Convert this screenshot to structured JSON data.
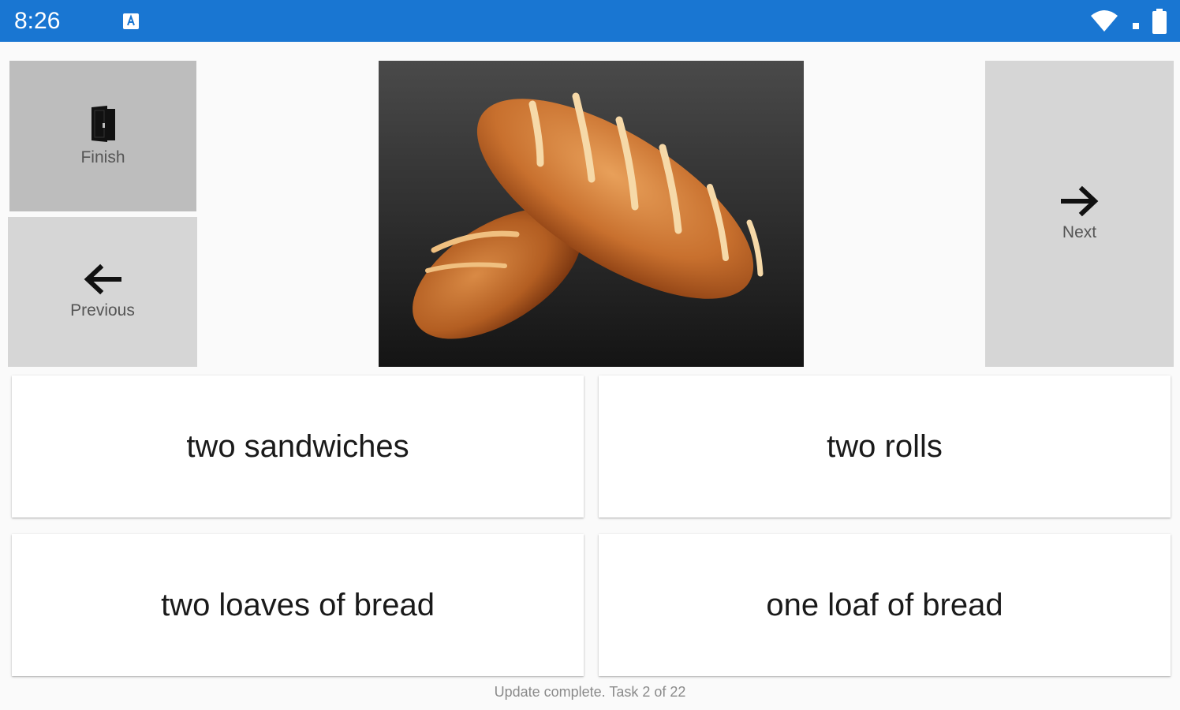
{
  "status_bar": {
    "time": "8:26",
    "icons": [
      "keyboard-a-icon",
      "wifi-icon",
      "signal-icon",
      "battery-icon"
    ],
    "color": "#1976d2"
  },
  "nav": {
    "finish_label": "Finish",
    "previous_label": "Previous",
    "next_label": "Next",
    "icons": {
      "finish": "door-exit-icon",
      "previous": "arrow-left-icon",
      "next": "arrow-right-icon"
    }
  },
  "question": {
    "image": "two-bread-loaves-photo"
  },
  "answers": [
    {
      "label": "two sandwiches"
    },
    {
      "label": "two rolls"
    },
    {
      "label": "two loaves of bread"
    },
    {
      "label": "one loaf of bread"
    }
  ],
  "footer": {
    "status": "Update complete. Task 2 of 22"
  }
}
